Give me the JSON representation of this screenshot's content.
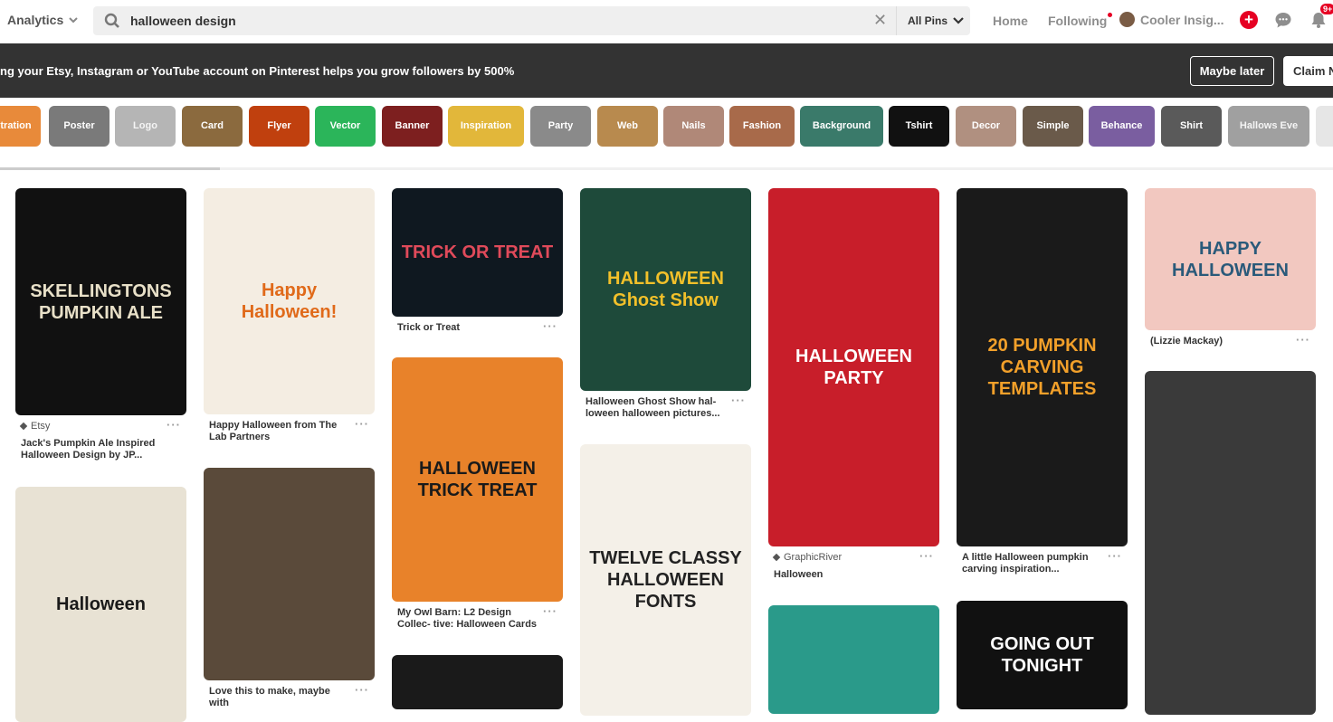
{
  "topbar": {
    "analytics": "Analytics",
    "search_value": "halloween design",
    "scope": "All Pins",
    "nav_home": "Home",
    "nav_following": "Following",
    "nav_user": "Cooler Insig...",
    "notif_badge": "9+"
  },
  "banner": {
    "text": "ng your Etsy, Instagram or YouTube account on Pinterest helps you grow followers by 500%",
    "maybe_later": "Maybe later",
    "claim": "Claim N"
  },
  "chips": [
    {
      "label": "tration",
      "color": "#e88a3a"
    },
    {
      "label": "Poster",
      "color": "#7a7a7a"
    },
    {
      "label": "Logo",
      "color": "#b5b5b5"
    },
    {
      "label": "Card",
      "color": "#8b6a3e"
    },
    {
      "label": "Flyer",
      "color": "#c0400e"
    },
    {
      "label": "Vector",
      "color": "#2bb55a"
    },
    {
      "label": "Banner",
      "color": "#7d1f1f"
    },
    {
      "label": "Inspiration",
      "color": "#e2b73a"
    },
    {
      "label": "Party",
      "color": "#8a8a8a"
    },
    {
      "label": "Web",
      "color": "#b88a4e"
    },
    {
      "label": "Nails",
      "color": "#b08878"
    },
    {
      "label": "Fashion",
      "color": "#a86a4a"
    },
    {
      "label": "Background",
      "color": "#3a7a6a"
    },
    {
      "label": "Tshirt",
      "color": "#111111"
    },
    {
      "label": "Decor",
      "color": "#b09080"
    },
    {
      "label": "Simple",
      "color": "#6a5a4a"
    },
    {
      "label": "Behance",
      "color": "#7a5ea0"
    },
    {
      "label": "Shirt",
      "color": "#5a5a5a"
    },
    {
      "label": "Hallows Eve",
      "color": "#a0a0a0"
    }
  ],
  "pins": [
    {
      "source": "Etsy",
      "title": "Jack's Pumpkin Ale Inspired Halloween Design by JP...",
      "img_text": "SKELLINGTONS PUMPKIN ALE",
      "img_bg": "#111111",
      "img_fg": "#e8e0c8"
    },
    {
      "source": "",
      "title": "",
      "img_text": "Halloween",
      "img_bg": "#e8e2d4",
      "img_fg": "#1a1a1a"
    },
    {
      "source": "",
      "title": "Happy Halloween from The Lab Partners",
      "img_text": "Happy Halloween!",
      "img_bg": "#f4ede2",
      "img_fg": "#e06a1a"
    },
    {
      "source": "",
      "title": "Love this to make, maybe with",
      "img_text": "",
      "img_bg": "#5a4a3a",
      "img_fg": "#ffffff"
    },
    {
      "source": "",
      "title": "Trick or Treat",
      "img_text": "TRICK OR TREAT",
      "img_bg": "#0f1820",
      "img_fg": "#e04a5a"
    },
    {
      "source": "",
      "title": "My Owl Barn: L2 Design Collec- tive: Halloween Cards",
      "img_text": "HALLOWEEN  TRICK TREAT",
      "img_bg": "#e8822a",
      "img_fg": "#1a1a1a"
    },
    {
      "source": "",
      "title": "",
      "img_text": "",
      "img_bg": "#1a1a1a",
      "img_fg": "#ff8a1a"
    },
    {
      "source": "",
      "title": "Halloween Ghost Show hal- loween halloween pictures...",
      "img_text": "HALLOWEEN Ghost Show",
      "img_bg": "#1e4a3a",
      "img_fg": "#f2c02a"
    },
    {
      "source": "",
      "title": "",
      "img_text": "TWELVE CLASSY HALLOWEEN FONTS",
      "img_bg": "#f4f0e8",
      "img_fg": "#222222"
    },
    {
      "source": "GraphicRiver",
      "title": "Halloween",
      "img_text": "HALLOWEEN PARTY",
      "img_bg": "#c81e2a",
      "img_fg": "#ffffff"
    },
    {
      "source": "",
      "title": "",
      "img_text": "",
      "img_bg": "#2a9a8a",
      "img_fg": "#ffffff"
    },
    {
      "source": "",
      "title": "A little Halloween pumpkin carving inspiration...",
      "img_text": "20 PUMPKIN CARVING TEMPLATES",
      "img_bg": "#1a1a1a",
      "img_fg": "#f2a02a"
    },
    {
      "source": "",
      "title": "",
      "img_text": "GOING OUT TONIGHT",
      "img_bg": "#111111",
      "img_fg": "#ffffff"
    },
    {
      "source": "",
      "title": "(Lizzie Mackay)",
      "img_text": "HAPPY HALLOWEEN",
      "img_bg": "#f2c8c0",
      "img_fg": "#2a5a7a"
    },
    {
      "source": "",
      "title": "",
      "img_text": "",
      "img_bg": "#3a3a3a",
      "img_fg": "#ffffff"
    }
  ]
}
